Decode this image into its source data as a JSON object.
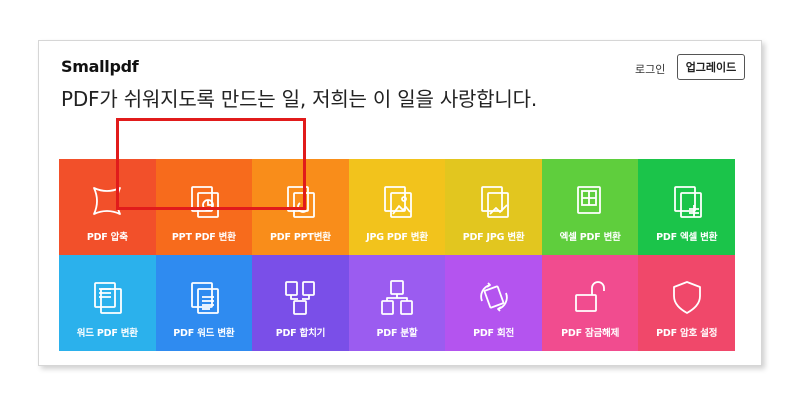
{
  "header": {
    "logo": "Smallpdf",
    "headline": "PDF가 쉬워지도록 만드는 일, 저희는 이 일을 사랑합니다.",
    "login": "로그인",
    "upgrade": "업그레이드"
  },
  "tools": [
    {
      "label": "PDF 압축",
      "icon": "compress-icon",
      "color": "#f2502a"
    },
    {
      "label": "PPT PDF 변환",
      "icon": "ppt-to-pdf-icon",
      "color": "#f76b1c"
    },
    {
      "label": "PDF PPT변환",
      "icon": "pdf-to-ppt-icon",
      "color": "#f98d1a"
    },
    {
      "label": "JPG PDF 변환",
      "icon": "jpg-to-pdf-icon",
      "color": "#f2c31c"
    },
    {
      "label": "PDF JPG 변환",
      "icon": "pdf-to-jpg-icon",
      "color": "#e2c61f"
    },
    {
      "label": "엑셀 PDF 변환",
      "icon": "excel-to-pdf-icon",
      "color": "#5fce3d"
    },
    {
      "label": "PDF 엑셀 변환",
      "icon": "pdf-to-excel-icon",
      "color": "#1bc44a"
    },
    {
      "label": "워드 PDF 변환",
      "icon": "word-to-pdf-icon",
      "color": "#2bb1ec"
    },
    {
      "label": "PDF 워드 변환",
      "icon": "pdf-to-word-icon",
      "color": "#2f8bf0"
    },
    {
      "label": "PDF 합치기",
      "icon": "merge-icon",
      "color": "#7a4fe8"
    },
    {
      "label": "PDF 분할",
      "icon": "split-icon",
      "color": "#9b5cf0"
    },
    {
      "label": "PDF 회전",
      "icon": "rotate-icon",
      "color": "#b454ef"
    },
    {
      "label": "PDF 잠금해제",
      "icon": "unlock-icon",
      "color": "#f14c8f"
    },
    {
      "label": "PDF 암호 설정",
      "icon": "protect-icon",
      "color": "#f0486a"
    }
  ],
  "highlight_color": "#e11b1b"
}
